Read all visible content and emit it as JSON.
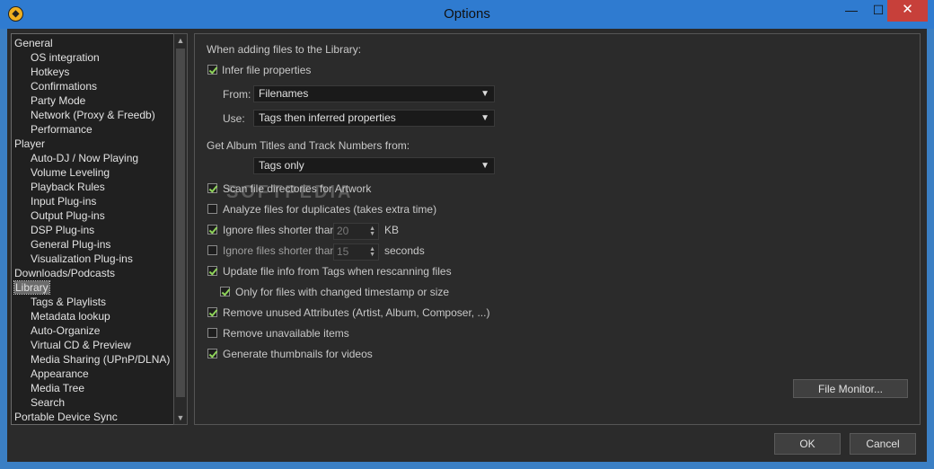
{
  "window": {
    "title": "Options",
    "minimize_glyph": "—",
    "maximize_glyph": "☐",
    "close_glyph": "✕"
  },
  "tree": {
    "items": [
      {
        "label": "General",
        "level": 0
      },
      {
        "label": "OS integration",
        "level": 1
      },
      {
        "label": "Hotkeys",
        "level": 1
      },
      {
        "label": "Confirmations",
        "level": 1
      },
      {
        "label": "Party Mode",
        "level": 1
      },
      {
        "label": "Network (Proxy & Freedb)",
        "level": 1
      },
      {
        "label": "Performance",
        "level": 1
      },
      {
        "label": "Player",
        "level": 0
      },
      {
        "label": "Auto-DJ / Now Playing",
        "level": 1
      },
      {
        "label": "Volume Leveling",
        "level": 1
      },
      {
        "label": "Playback Rules",
        "level": 1
      },
      {
        "label": "Input Plug-ins",
        "level": 1
      },
      {
        "label": "Output Plug-ins",
        "level": 1
      },
      {
        "label": "DSP Plug-ins",
        "level": 1
      },
      {
        "label": "General Plug-ins",
        "level": 1
      },
      {
        "label": "Visualization Plug-ins",
        "level": 1
      },
      {
        "label": "Downloads/Podcasts",
        "level": 0
      },
      {
        "label": "Library",
        "level": 0,
        "selected": true
      },
      {
        "label": "Tags & Playlists",
        "level": 1
      },
      {
        "label": "Metadata lookup",
        "level": 1
      },
      {
        "label": "Auto-Organize",
        "level": 1
      },
      {
        "label": "Virtual CD & Preview",
        "level": 1
      },
      {
        "label": "Media Sharing (UPnP/DLNA)",
        "level": 1
      },
      {
        "label": "Appearance",
        "level": 1
      },
      {
        "label": "Media Tree",
        "level": 1
      },
      {
        "label": "Search",
        "level": 1
      },
      {
        "label": "Portable Device Sync",
        "level": 0
      }
    ]
  },
  "panel": {
    "heading_adding": "When adding files to the Library:",
    "infer_label": "Infer file properties",
    "infer_checked": true,
    "from_label": "From:",
    "from_value": "Filenames",
    "use_label": "Use:",
    "use_value": "Tags then inferred properties",
    "heading_album": "Get Album Titles and Track Numbers from:",
    "album_value": "Tags only",
    "scan_label": "Scan file directories for Artwork",
    "scan_checked": true,
    "analyze_label": "Analyze files for duplicates (takes extra time)",
    "analyze_checked": false,
    "ignore_kb_label": "Ignore files shorter than",
    "ignore_kb_checked": true,
    "ignore_kb_value": "20",
    "ignore_kb_unit": "KB",
    "ignore_sec_label": "Ignore files shorter than",
    "ignore_sec_checked": false,
    "ignore_sec_value": "15",
    "ignore_sec_unit": "seconds",
    "update_label": "Update file info from Tags when rescanning files",
    "update_checked": true,
    "only_changed_label": "Only for files with changed timestamp or size",
    "only_changed_checked": true,
    "remove_unused_label": "Remove unused Attributes (Artist, Album, Composer, ...)",
    "remove_unused_checked": true,
    "remove_unavailable_label": "Remove unavailable items",
    "remove_unavailable_checked": false,
    "thumbnails_label": "Generate thumbnails for videos",
    "thumbnails_checked": true,
    "file_monitor_button": "File Monitor..."
  },
  "watermark": "SOFTPEDIA",
  "buttons": {
    "ok": "OK",
    "cancel": "Cancel"
  },
  "icons": {
    "app": "mediamonkey-icon",
    "dropdown": "chevron-down-icon",
    "spin_up": "spin-up-icon",
    "spin_down": "spin-down-icon",
    "scroll_up": "scroll-up-icon",
    "scroll_down": "scroll-down-icon"
  },
  "colors": {
    "titlebar": "#2f7bd0",
    "background": "#2b2b2b",
    "checkmark": "#8fd45a",
    "close": "#c7403a"
  }
}
